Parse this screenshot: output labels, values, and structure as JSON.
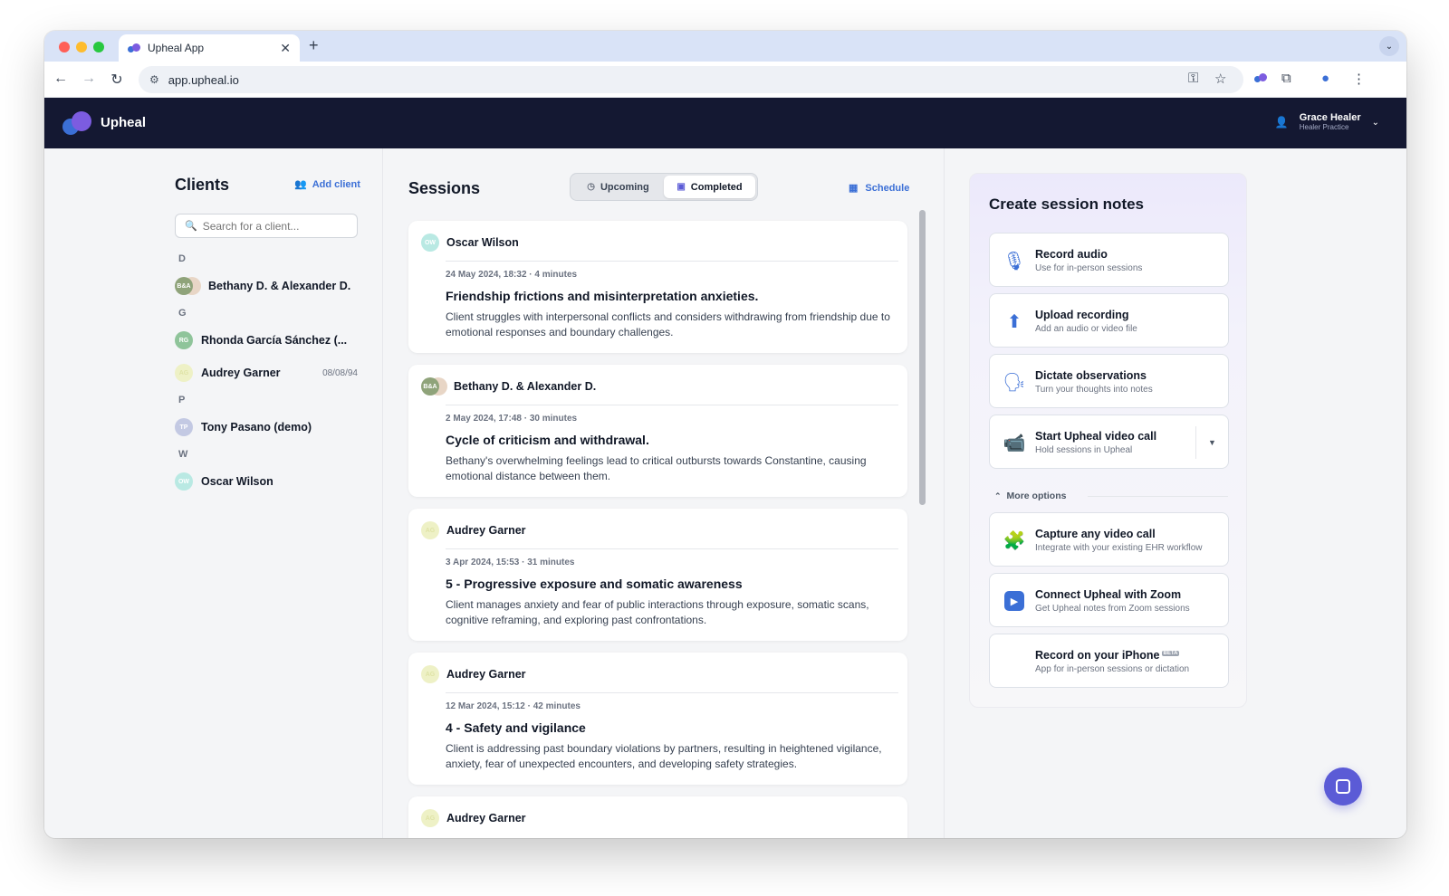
{
  "browser": {
    "tab_title": "Upheal App",
    "url": "app.upheal.io"
  },
  "app": {
    "brand": "Upheal",
    "colors": {
      "header_bg": "#141832",
      "accent": "#3b6fd6",
      "brand_purple": "#5b5bd6"
    },
    "user": {
      "name": "Grace Healer",
      "practice": "Healer Practice"
    }
  },
  "clients": {
    "title": "Clients",
    "add_label": "Add client",
    "search_placeholder": "Search for a client...",
    "groups": [
      {
        "letter": "D",
        "items": [
          {
            "name": "Bethany D. & Alexander D.",
            "initials": "B&A",
            "date": ""
          }
        ]
      },
      {
        "letter": "G",
        "items": [
          {
            "name": "Rhonda García Sánchez (...",
            "initials": "RG",
            "date": ""
          },
          {
            "name": "Audrey Garner",
            "initials": "AG",
            "date": "08/08/94"
          }
        ]
      },
      {
        "letter": "P",
        "items": [
          {
            "name": "Tony Pasano (demo)",
            "initials": "TP",
            "date": ""
          }
        ]
      },
      {
        "letter": "W",
        "items": [
          {
            "name": "Oscar Wilson",
            "initials": "OW",
            "date": ""
          }
        ]
      }
    ]
  },
  "sessions": {
    "title": "Sessions",
    "tabs": {
      "upcoming": "Upcoming",
      "completed": "Completed",
      "active": "completed"
    },
    "schedule_label": "Schedule",
    "items": [
      {
        "client": "Oscar Wilson",
        "initials": "OW",
        "meta": "24 May 2024, 18:32 · 4 minutes",
        "title": "Friendship frictions and misinterpretation anxieties.",
        "summary": "Client struggles with interpersonal conflicts and considers withdrawing from friendship due to emotional responses and boundary challenges."
      },
      {
        "client": "Bethany D. & Alexander D.",
        "initials": "B&A",
        "meta": "2 May 2024, 17:48 · 30 minutes",
        "title": "Cycle of criticism and withdrawal.",
        "summary": "Bethany's overwhelming feelings lead to critical outbursts towards Constantine, causing emotional distance between them."
      },
      {
        "client": "Audrey Garner",
        "initials": "AG",
        "meta": "3 Apr 2024, 15:53 · 31 minutes",
        "title": "5 - Progressive exposure and somatic awareness",
        "summary": "Client manages anxiety and fear of public interactions through exposure, somatic scans, cognitive reframing, and exploring past confrontations."
      },
      {
        "client": "Audrey Garner",
        "initials": "AG",
        "meta": "12 Mar 2024, 15:12 · 42 minutes",
        "title": "4 - Safety and vigilance",
        "summary": "Client is addressing past boundary violations by partners, resulting in heightened vigilance, anxiety, fear of unexpected encounters, and developing safety strategies."
      },
      {
        "client": "Audrey Garner",
        "initials": "AG",
        "meta": "",
        "title": "",
        "summary": ""
      }
    ]
  },
  "notes": {
    "title": "Create session notes",
    "actions": [
      {
        "title": "Record audio",
        "sub": "Use for in-person sessions",
        "icon": "microphone-icon"
      },
      {
        "title": "Upload recording",
        "sub": "Add an audio or video file",
        "icon": "upload-icon"
      },
      {
        "title": "Dictate observations",
        "sub": "Turn your thoughts into notes",
        "icon": "dictate-icon"
      },
      {
        "title": "Start Upheal video call",
        "sub": "Hold sessions in Upheal",
        "icon": "video-camera-icon"
      }
    ],
    "more_options": "More options",
    "more_actions": [
      {
        "title": "Capture any video call",
        "sub": "Integrate with your existing EHR workflow",
        "icon": "puzzle-icon"
      },
      {
        "title": "Connect Upheal with Zoom",
        "sub": "Get Upheal notes from Zoom sessions",
        "icon": "zoom-icon"
      },
      {
        "title": "Record on your iPhone",
        "sub": "App for in-person sessions or dictation",
        "icon": "apple-icon",
        "badge": "BETA"
      }
    ]
  }
}
